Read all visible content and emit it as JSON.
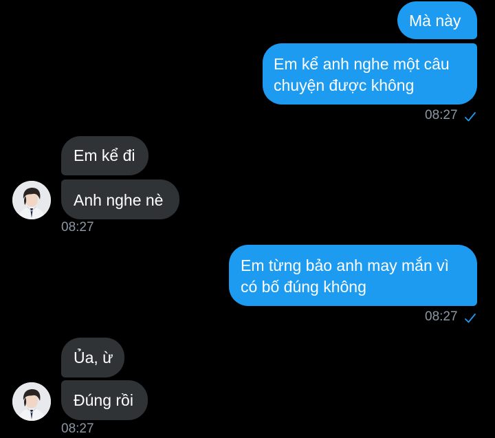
{
  "colors": {
    "background": "#000000",
    "outgoing_bubble": "#1d9bf0",
    "incoming_bubble": "#2f3336",
    "timestamp": "#8b98a5",
    "read_check": "#1d9bf0"
  },
  "messages": [
    {
      "direction": "outgoing",
      "text": "Mà này"
    },
    {
      "direction": "outgoing",
      "text": "Em kể anh nghe một câu\nchuyện được không",
      "time": "08:27",
      "status_icon": "check-icon"
    },
    {
      "direction": "incoming",
      "text": "Em kể đi"
    },
    {
      "direction": "incoming",
      "text": "Anh nghe nè",
      "time": "08:27",
      "avatar": "avatar"
    },
    {
      "direction": "outgoing",
      "text": "Em từng bảo anh may mắn vì\ncó bố đúng không",
      "time": "08:27",
      "status_icon": "check-icon"
    },
    {
      "direction": "incoming",
      "text": "Ủa, ừ"
    },
    {
      "direction": "incoming",
      "text": "Đúng rồi",
      "time": "08:27",
      "avatar": "avatar"
    }
  ]
}
